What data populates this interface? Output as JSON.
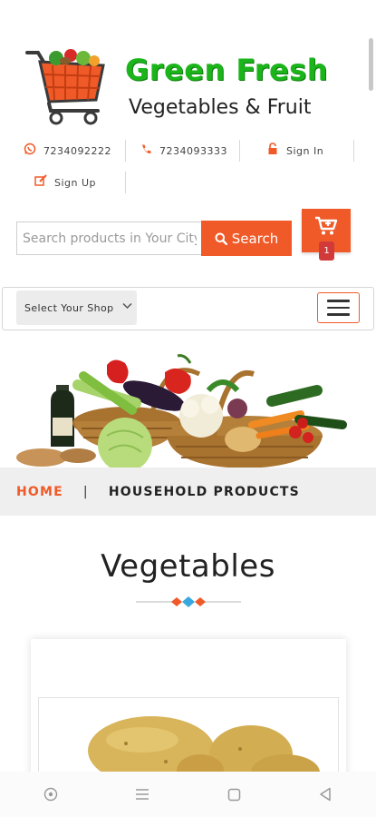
{
  "brand": {
    "name": "Green Fresh",
    "tagline": "Vegetables & Fruit"
  },
  "contact": {
    "phone1": "7234092222",
    "phone2": "7234093333",
    "signin_label": "Sign In",
    "signup_label": "Sign Up"
  },
  "search": {
    "placeholder": "Search products in Your City",
    "button_label": "Search"
  },
  "cart": {
    "count": "1"
  },
  "shop": {
    "select_label": "Select Your Shop"
  },
  "breadcrumb": {
    "home": "HOME",
    "separator": "|",
    "current": "HOUSEHOLD PRODUCTS"
  },
  "section": {
    "title": "Vegetables"
  },
  "colors": {
    "accent": "#f05a28",
    "brand_green": "#1bb51b",
    "divider_blue": "#3aa8e0"
  },
  "icons": {
    "whatsapp": "whatsapp-icon",
    "phone": "phone-icon",
    "signin": "lock-icon",
    "signup": "edit-icon",
    "search": "search-icon",
    "cart": "cart-icon",
    "menu": "hamburger-icon",
    "nav_assistant": "assistant-icon",
    "nav_recent": "recent-apps-icon",
    "nav_home": "home-icon",
    "nav_back": "back-icon"
  }
}
